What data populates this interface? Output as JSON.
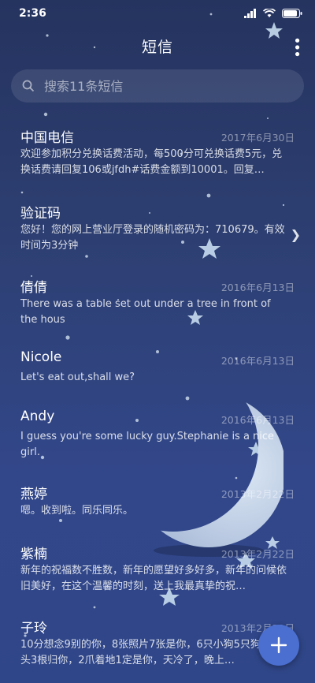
{
  "status_bar": {
    "time": "2:36"
  },
  "header": {
    "title": "短信"
  },
  "search": {
    "placeholder": "搜索11条短信"
  },
  "messages": [
    {
      "name": "中国电信",
      "date": "2017年6月30日",
      "preview": "欢迎参加积分兑换话费活动，每500分可兑换话费5元，兑换话费请回复106或jfdh#话费金额到10001。回复…"
    },
    {
      "name": "验证码",
      "date": "",
      "preview": "您好！您的网上营业厅登录的随机密码为：710679。有效时间为3分钟"
    },
    {
      "name": "倩倩",
      "date": "2016年6月13日",
      "preview": "There was a table set out under a tree in front of the hous"
    },
    {
      "name": "Nicole",
      "date": "2016年6月13日",
      "preview": "Let's eat out,shall we?"
    },
    {
      "name": "Andy",
      "date": "2016年6月13日",
      "preview": "I guess you're some lucky guy.Stephanie is a nice girl."
    },
    {
      "name": "燕婷",
      "date": "2013年2月22日",
      "preview": "嗯。收到啦。同乐同乐。"
    },
    {
      "name": "紫楠",
      "date": "2013年2月22日",
      "preview": "新年的祝福数不胜数，新年的愿望好多好多，新年的问候依旧美好，在这个温馨的时刻，送上我最真挚的祝…"
    },
    {
      "name": "子玲",
      "date": "2013年2月22日",
      "preview": "10分想念9别的你，8张照片7张是你，6只小狗5只狗4根骨头3根归你，2爪着地1定是你，天冷了，晚上…"
    }
  ],
  "icons": {
    "search": "search-icon",
    "more": "more-vertical-icon",
    "chevron": "chevron-right-icon",
    "fab": "plus-icon"
  },
  "colors": {
    "accent": "#4b6fd0",
    "background": "#2d3f72"
  }
}
